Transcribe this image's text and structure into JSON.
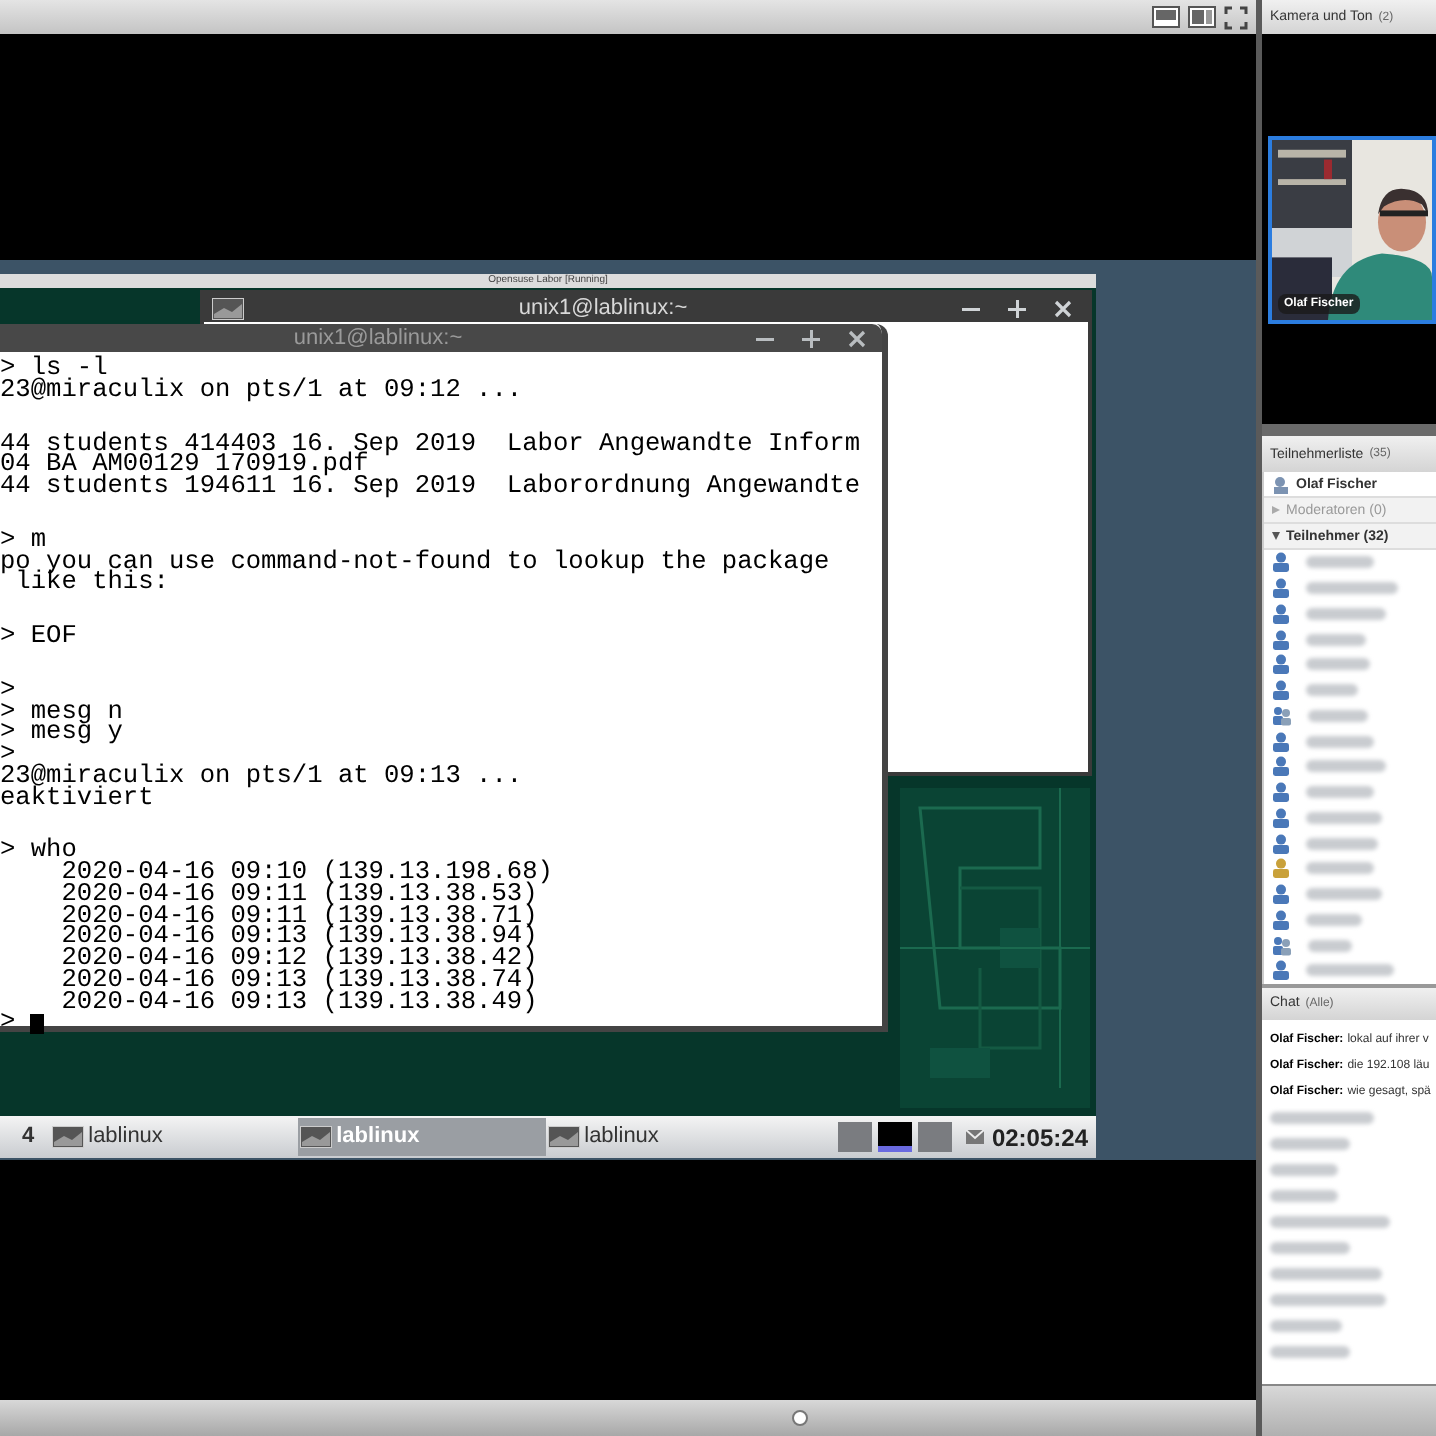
{
  "vm": {
    "title": "Opensuse Labor [Running]",
    "back_terminal": {
      "title": "unix1@lablinux:~"
    },
    "front_terminal": {
      "title": "unix1@lablinux:~",
      "cursor": true,
      "blocks": [
        {
          "lines": [
            "> ls -l",
            "23@miraculix on pts/1 at 09:12 ..."
          ]
        },
        {
          "lines": [
            "44 students 414403 16. Sep 2019  Labor Angewandte Inform",
            "04 BA AM00129 170919.pdf",
            "44 students 194611 16. Sep 2019  Laborordnung Angewandte"
          ]
        },
        {
          "lines": [
            "> m",
            "po you can use command-not-found to lookup the package",
            " like this:"
          ]
        },
        {
          "lines": [
            "> EOF"
          ]
        },
        {
          "lines": [
            ">",
            "> mesg n",
            "> mesg y",
            ">",
            "23@miraculix on pts/1 at 09:13 ...",
            "eaktiviert"
          ]
        },
        {
          "lines": [
            "> who",
            "    2020-04-16 09:10 (139.13.198.68)",
            "    2020-04-16 09:11 (139.13.38.53)",
            "    2020-04-16 09:11 (139.13.38.71)",
            "    2020-04-16 09:13 (139.13.38.94)",
            "    2020-04-16 09:12 (139.13.38.42)",
            "    2020-04-16 09:13 (139.13.38.74)",
            "    2020-04-16 09:13 (139.13.38.49)",
            "> "
          ]
        }
      ]
    },
    "taskbar": {
      "workspace": "4",
      "tasks": [
        {
          "label": "lablinux",
          "selected": false
        },
        {
          "label": "lablinux",
          "selected": true
        },
        {
          "label": "lablinux",
          "selected": false
        }
      ],
      "pager": [
        {
          "selected": false
        },
        {
          "selected": true
        },
        {
          "selected": false
        }
      ],
      "clock": "02:05:24"
    }
  },
  "camera_panel": {
    "title": "Kamera und Ton",
    "count": "(2)",
    "video": {
      "kind": "picture",
      "name_label": "Olaf Fischer"
    }
  },
  "participants_panel": {
    "title": "Teilnehmerliste",
    "count": "(35)",
    "presenter": "Olaf Fischer",
    "groups": [
      {
        "label": "Moderatoren (0)",
        "expanded": false
      },
      {
        "label": "Teilnehmer (32)",
        "expanded": true
      }
    ],
    "participants": [
      {
        "kind": "single",
        "color": "#4a78b8"
      },
      {
        "kind": "single",
        "color": "#4a78b8"
      },
      {
        "kind": "single",
        "color": "#4a78b8"
      },
      {
        "kind": "single",
        "color": "#4a78b8"
      },
      {
        "kind": "single",
        "color": "#4a78b8"
      },
      {
        "kind": "single",
        "color": "#4a78b8"
      },
      {
        "kind": "pair",
        "color": "#4a78b8"
      },
      {
        "kind": "single",
        "color": "#4a78b8"
      },
      {
        "kind": "single",
        "color": "#4a78b8"
      },
      {
        "kind": "single",
        "color": "#4a78b8"
      },
      {
        "kind": "single",
        "color": "#4a78b8"
      },
      {
        "kind": "single",
        "color": "#4a78b8"
      },
      {
        "kind": "single",
        "color": "#c9a13a"
      },
      {
        "kind": "single",
        "color": "#4a78b8"
      },
      {
        "kind": "single",
        "color": "#4a78b8"
      },
      {
        "kind": "pair",
        "color": "#4a78b8"
      },
      {
        "kind": "single",
        "color": "#4a78b8"
      }
    ]
  },
  "chat_panel": {
    "title": "Chat",
    "scope": "(Alle)",
    "messages": [
      {
        "kind": "text",
        "sender": "Olaf Fischer:",
        "text": "lokal auf ihrer v"
      },
      {
        "kind": "text",
        "sender": "Olaf Fischer:",
        "text": "die 192.108 läu"
      },
      {
        "kind": "text",
        "sender": "Olaf Fischer:",
        "text": "wie gesagt, spä"
      },
      {
        "kind": "blurred"
      },
      {
        "kind": "blurred"
      },
      {
        "kind": "blurred"
      },
      {
        "kind": "blurred"
      },
      {
        "kind": "blurred"
      },
      {
        "kind": "blurred"
      },
      {
        "kind": "blurred"
      },
      {
        "kind": "blurred"
      },
      {
        "kind": "blurred"
      },
      {
        "kind": "blurred"
      }
    ]
  }
}
